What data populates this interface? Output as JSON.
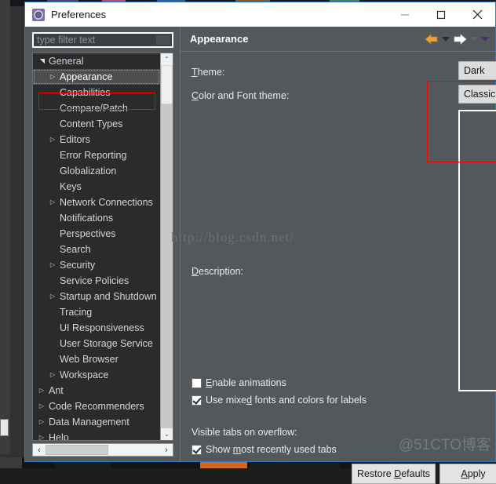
{
  "window": {
    "title": "Preferences",
    "icon": "gear-icon",
    "controls": {
      "minimize": "—",
      "maximize": "□",
      "close": "✕"
    }
  },
  "sidebar": {
    "filter": {
      "placeholder": "type filter text",
      "value": ""
    },
    "tree": [
      {
        "label": "General",
        "indent": 0,
        "arrow": "open",
        "selected": false
      },
      {
        "label": "Appearance",
        "indent": 1,
        "arrow": "closed",
        "selected": true
      },
      {
        "label": "Capabilities",
        "indent": 1,
        "arrow": "none",
        "selected": false
      },
      {
        "label": "Compare/Patch",
        "indent": 1,
        "arrow": "none",
        "selected": false
      },
      {
        "label": "Content Types",
        "indent": 1,
        "arrow": "none",
        "selected": false
      },
      {
        "label": "Editors",
        "indent": 1,
        "arrow": "closed",
        "selected": false
      },
      {
        "label": "Error Reporting",
        "indent": 1,
        "arrow": "none",
        "selected": false
      },
      {
        "label": "Globalization",
        "indent": 1,
        "arrow": "none",
        "selected": false
      },
      {
        "label": "Keys",
        "indent": 1,
        "arrow": "none",
        "selected": false
      },
      {
        "label": "Network Connections",
        "indent": 1,
        "arrow": "closed",
        "selected": false
      },
      {
        "label": "Notifications",
        "indent": 1,
        "arrow": "none",
        "selected": false
      },
      {
        "label": "Perspectives",
        "indent": 1,
        "arrow": "none",
        "selected": false
      },
      {
        "label": "Search",
        "indent": 1,
        "arrow": "none",
        "selected": false
      },
      {
        "label": "Security",
        "indent": 1,
        "arrow": "closed",
        "selected": false
      },
      {
        "label": "Service Policies",
        "indent": 1,
        "arrow": "none",
        "selected": false
      },
      {
        "label": "Startup and Shutdown",
        "indent": 1,
        "arrow": "closed",
        "selected": false
      },
      {
        "label": "Tracing",
        "indent": 1,
        "arrow": "none",
        "selected": false
      },
      {
        "label": "UI Responsiveness",
        "indent": 1,
        "arrow": "none",
        "selected": false
      },
      {
        "label": "User Storage Service",
        "indent": 1,
        "arrow": "none",
        "selected": false
      },
      {
        "label": "Web Browser",
        "indent": 1,
        "arrow": "none",
        "selected": false
      },
      {
        "label": "Workspace",
        "indent": 1,
        "arrow": "closed",
        "selected": false
      },
      {
        "label": "Ant",
        "indent": 0,
        "arrow": "closed",
        "selected": false
      },
      {
        "label": "Code Recommenders",
        "indent": 0,
        "arrow": "closed",
        "selected": false
      },
      {
        "label": "Data Management",
        "indent": 0,
        "arrow": "closed",
        "selected": false
      },
      {
        "label": "Help",
        "indent": 0,
        "arrow": "closed",
        "selected": false
      }
    ],
    "scroll_left_icon": "‹",
    "scroll_right_icon": "›",
    "scroll_up_icon": "⌃",
    "scroll_down_icon": "⌄"
  },
  "page": {
    "title": "Appearance",
    "nav": {
      "back_icon": "arrow-left-icon",
      "back_menu_icon": "chevron-down-icon",
      "forward_icon": "arrow-right-icon",
      "forward_menu_icon": "chevron-down-icon",
      "view_menu_icon": "chevron-down-icon"
    },
    "fields": {
      "theme_label": "Theme:",
      "theme_value": "Dark",
      "color_font_label": "Color and Font theme:",
      "color_font_value": "Classic Theme (current)",
      "combo_arrow": "⌄"
    },
    "description_label": "Description:",
    "checkboxes": [
      {
        "label": "Enable animations",
        "checked": false
      },
      {
        "label": "Use mixed fonts and colors for labels",
        "checked": true
      }
    ],
    "visible_tabs_label": "Visible tabs on overflow:",
    "mru_checkbox": {
      "label": "Show most recently used tabs",
      "checked": true
    },
    "buttons": {
      "restore_defaults": "Restore Defaults",
      "apply": "Apply"
    }
  },
  "watermarks": {
    "url": "http://blog.csdn.net/",
    "site": "@51CTO博客"
  },
  "colors": {
    "dialog_bg": "#53585c",
    "tree_bg": "#2b2b2b",
    "accent_border": "#2d7cc4",
    "annotation": "#ff0000",
    "back_arrow": "#e8a33d",
    "forward_arrow": "#ffffff",
    "taskbar_active": "#d2691e"
  }
}
